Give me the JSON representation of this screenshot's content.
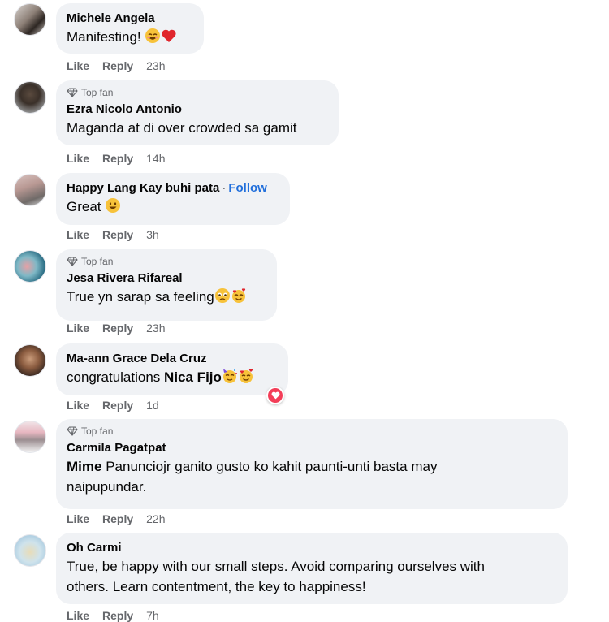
{
  "comments": [
    {
      "author": "Michele Angela",
      "text": "Manifesting!",
      "like": "Like",
      "reply": "Reply",
      "time": "23h"
    },
    {
      "badge": "Top fan",
      "author": "Ezra Nicolo Antonio",
      "text": "Maganda at di over crowded sa gamit",
      "like": "Like",
      "reply": "Reply",
      "time": "14h"
    },
    {
      "author": "Happy Lang Kay buhi pata",
      "follow": "Follow",
      "text": "Great",
      "like": "Like",
      "reply": "Reply",
      "time": "3h"
    },
    {
      "badge": "Top fan",
      "author": "Jesa Rivera Rifareal",
      "text": "True yn sarap sa feeling",
      "like": "Like",
      "reply": "Reply",
      "time": "23h"
    },
    {
      "author": "Ma-ann Grace Dela Cruz",
      "text": "congratulations",
      "mention": "Nica Fijo",
      "reaction": "heart-reaction",
      "like": "Like",
      "reply": "Reply",
      "time": "1d"
    },
    {
      "badge": "Top fan",
      "author": "Carmila Pagatpat",
      "mention": "Mime",
      "text_line1": "Panunciojr ganito gusto ko kahit paunti-unti basta may",
      "text_line2": "naipupundar.",
      "like": "Like",
      "reply": "Reply",
      "time": "22h"
    },
    {
      "author": "Oh Carmi",
      "text_line1": "True, be happy with our small steps. Avoid comparing ourselves with",
      "text_line2": "others. Learn contentment, the key to happiness!",
      "like": "Like",
      "reply": "Reply",
      "time": "7h"
    }
  ],
  "colors": {
    "bubble": "#f0f2f5",
    "action_text": "#65676b",
    "follow_link": "#216fdb",
    "heart_reaction": "#f33e58"
  }
}
